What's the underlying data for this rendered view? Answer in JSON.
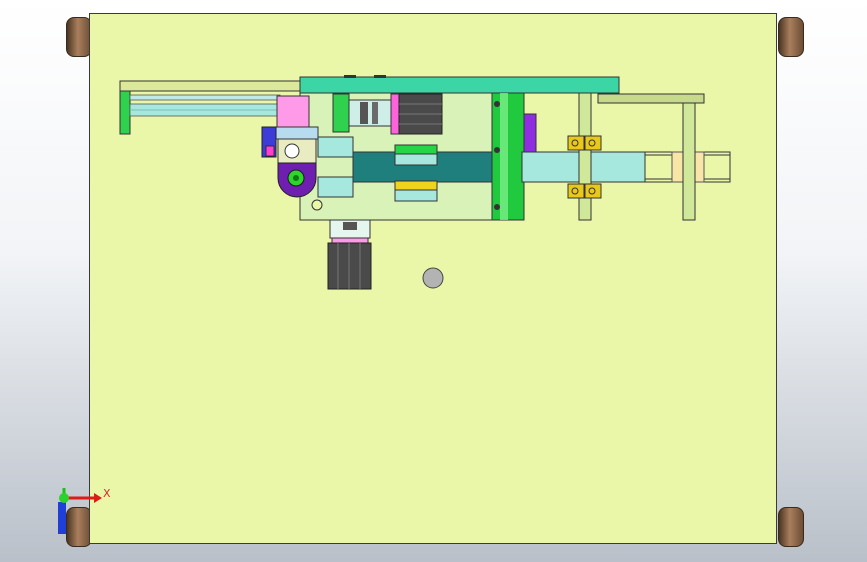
{
  "viewport": {
    "background_top": "#ffffff",
    "background_bottom": "#b9c0c9"
  },
  "colors": {
    "plate": "#eaf7a8",
    "teal_bar": "#1e7f7c",
    "light_cyan": "#a6e8de",
    "light_green": "#d8f2b8",
    "green_column": "#21c93f",
    "magenta_block": "#ff4fd8",
    "violet_block": "#7e1fd0",
    "yellow_clamp": "#e9c81a",
    "motor_dark": "#444444",
    "foot_brown": "#8b6446"
  },
  "triad": {
    "x_label": "X",
    "x_color": "#e01919",
    "y_color": "#1ac31a",
    "z_color": "#1f3fd8",
    "origin_color": "#2ad22a"
  }
}
